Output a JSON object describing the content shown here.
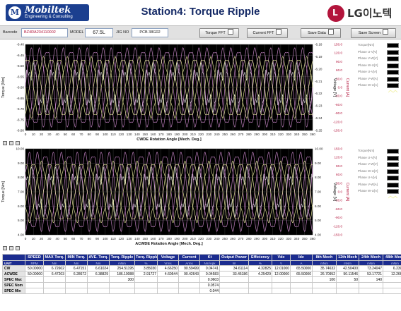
{
  "header": {
    "logo_mark": "M",
    "logo_name": "Mobiltek",
    "logo_tagline": "Engineering & Consulting",
    "title": "Station4: Torque Ripple",
    "brand_mark": "L",
    "brand": "LG이노텍"
  },
  "info_bar": {
    "barcode_label": "Barcode",
    "barcode_value": "BZ4RA234110002",
    "model_label": "MODEL",
    "model_value": "67.5L",
    "jig_label": "JIG NO",
    "jig_value": "PCB 38G02",
    "torque_fft_label": "Torque FFT",
    "current_fft_label": "Current FFT",
    "save_data_label": "Save Data",
    "save_screen_label": "Save Screen"
  },
  "colors": {
    "plot_bg": "#000000",
    "torque": "#f2f2f2",
    "current": "#cc88cc",
    "current_alt": "#f0f0a0",
    "right_axis": "#b3153c",
    "table_header": "#1b2c8f"
  },
  "chart_data": [
    {
      "type": "line",
      "xlabel": "CWDE Rotation Angle [Mech. Deg.]",
      "ylabel": "Torque [Nm]",
      "y2label": "Current [A]",
      "y3label": "Voltage [V]",
      "xlim": [
        0,
        360
      ],
      "x_ticks": [
        0,
        10,
        20,
        30,
        40,
        50,
        60,
        70,
        80,
        90,
        100,
        110,
        120,
        130,
        140,
        150,
        160,
        170,
        180,
        190,
        200,
        210,
        220,
        230,
        240,
        250,
        260,
        270,
        280,
        290,
        300,
        310,
        320,
        330,
        340,
        350,
        360
      ],
      "ylim": [
        -6.8,
        -6.4
      ],
      "y_ticks": [
        "-6.40",
        "-6.45",
        "-6.50",
        "-6.55",
        "-6.60",
        "-6.65",
        "-6.70",
        "-6.75",
        "-6.80"
      ],
      "y3_ticks": [
        "-6.18",
        "-6.19",
        "-6.20",
        "-6.21",
        "-6.22",
        "-6.23",
        "-6.24",
        "-6.25"
      ],
      "y2_ticks": [
        "150.0",
        "120.0",
        "90.0",
        "60.0",
        "30.0",
        "0.0",
        "-30.0",
        "-60.0",
        "-90.0",
        "-120.0",
        "-150.0"
      ],
      "grid": true,
      "legend": "right",
      "series": [
        {
          "name": "Torque[Nm]",
          "style": "ripple",
          "cycles": 12,
          "phase": 0,
          "amp": 0.85
        },
        {
          "name": "Phase U-V[V]",
          "style": "sine",
          "cycles": 12,
          "phase": 0,
          "amp": 0.9
        },
        {
          "name": "Phase V-W[V]",
          "style": "sine",
          "cycles": 12,
          "phase": 120,
          "amp": 0.9
        },
        {
          "name": "Phase W-U[V]",
          "style": "sine",
          "cycles": 12,
          "phase": 240,
          "amp": 0.9
        },
        {
          "name": "Phase U-V[A]",
          "style": "sine",
          "cycles": 12,
          "phase": 60,
          "amp": 0.7
        },
        {
          "name": "Phase V-W[A]",
          "style": "sine",
          "cycles": 12,
          "phase": 180,
          "amp": 0.7
        },
        {
          "name": "Phase W-U[A]",
          "style": "sine",
          "cycles": 12,
          "phase": 300,
          "amp": 0.7
        }
      ]
    },
    {
      "type": "line",
      "xlabel": "ACWDE Rotation Angle [Mech. Deg.]",
      "ylabel": "Torque [Nm]",
      "y2label": "Current [A]",
      "y3label": "Voltage [V]",
      "xlim": [
        0,
        360
      ],
      "x_ticks": [
        0,
        10,
        20,
        30,
        40,
        50,
        60,
        70,
        80,
        90,
        100,
        110,
        120,
        130,
        140,
        150,
        160,
        170,
        180,
        190,
        200,
        210,
        220,
        230,
        240,
        250,
        260,
        270,
        280,
        290,
        300,
        310,
        320,
        330,
        340,
        350,
        360
      ],
      "ylim": [
        4.0,
        10.0
      ],
      "y_ticks": [
        "10.00",
        "9.00",
        "8.00",
        "7.00",
        "6.00",
        "5.00",
        "4.00"
      ],
      "y3_ticks": [
        "10.00",
        "9.00",
        "8.00",
        "7.00",
        "6.00",
        "5.00",
        "4.00"
      ],
      "y2_ticks": [
        "150.0",
        "120.0",
        "90.0",
        "60.0",
        "30.0",
        "0.0",
        "-30.0",
        "-60.0",
        "-90.0",
        "-120.0",
        "-150.0"
      ],
      "grid": true,
      "legend": "right",
      "series": [
        {
          "name": "Torque[Nm]",
          "style": "ripple",
          "cycles": 12,
          "phase": 30,
          "amp": 0.85
        },
        {
          "name": "Phase U-V[V]",
          "style": "sine",
          "cycles": 12,
          "phase": 30,
          "amp": 0.9
        },
        {
          "name": "Phase V-W[V]",
          "style": "sine",
          "cycles": 12,
          "phase": 150,
          "amp": 0.9
        },
        {
          "name": "Phase W-U[V]",
          "style": "sine",
          "cycles": 12,
          "phase": 270,
          "amp": 0.9
        },
        {
          "name": "Phase U-V[A]",
          "style": "sine",
          "cycles": 12,
          "phase": 90,
          "amp": 0.7
        },
        {
          "name": "Phase V-W[A]",
          "style": "sine",
          "cycles": 12,
          "phase": 210,
          "amp": 0.7
        },
        {
          "name": "Phase W-U[A]",
          "style": "sine",
          "cycles": 12,
          "phase": 330,
          "amp": 0.7
        }
      ]
    }
  ],
  "table": {
    "headers": [
      "SPEED",
      "MAX Torq.",
      "MIN Torq.",
      "AVE. Torq.",
      "Torq. Ripple",
      "Torq. Ripple",
      "Voltage",
      "Current",
      "Kt",
      "Output Power",
      "Efficiency",
      "Vdc",
      "Idc",
      "8th Mech",
      "12th Mech",
      "24th Mech",
      "48th Mech"
    ],
    "units_label": "UNIT",
    "units": [
      "RPM",
      "Nm",
      "Nm",
      "Nm",
      "mNm",
      "%",
      "Vrms",
      "Arms",
      "Nm/Apk",
      "W",
      "%",
      "V",
      "A",
      "mNm",
      "mNm",
      "mNm",
      "mNm"
    ],
    "rows": [
      {
        "label": "CW",
        "values": [
          "50.00000",
          "6.72602",
          "6.47151",
          "6.61024",
          "254.51195",
          "3.85030",
          "4.66250",
          "90.59499",
          "0.04741",
          "34.61114",
          "4.32825",
          "12.01000",
          "65.50000",
          "35.74632",
          "42.50400",
          "73.24047",
          "6.23099"
        ]
      },
      {
        "label": "ACWDE",
        "values": [
          "50.00000",
          "6.47203",
          "6.28672",
          "6.38829",
          "186.10088",
          "2.91727",
          "4.60544",
          "90.42643",
          "0.04583",
          "33.45186",
          "4.25429",
          "12.00000",
          "65.50000",
          "26.70952",
          "50.11546",
          "53.17721",
          "12.26608"
        ]
      },
      {
        "label": "SPEC Max",
        "values": [
          "",
          "",
          "",
          "",
          "300",
          "",
          "",
          "",
          "0.0603",
          "",
          "",
          "",
          "",
          "100",
          "50",
          "140",
          "50"
        ]
      },
      {
        "label": "SPEC Nom",
        "values": [
          "",
          "",
          "",
          "",
          "",
          "",
          "",
          "",
          "0.0574",
          "",
          "",
          "",
          "",
          "",
          "",
          "",
          ""
        ]
      },
      {
        "label": "SPEC Min",
        "values": [
          "",
          "",
          "",
          "",
          "",
          "",
          "",
          "",
          "0.044",
          "",
          "",
          "",
          "",
          "",
          "",
          "",
          ""
        ]
      }
    ]
  }
}
